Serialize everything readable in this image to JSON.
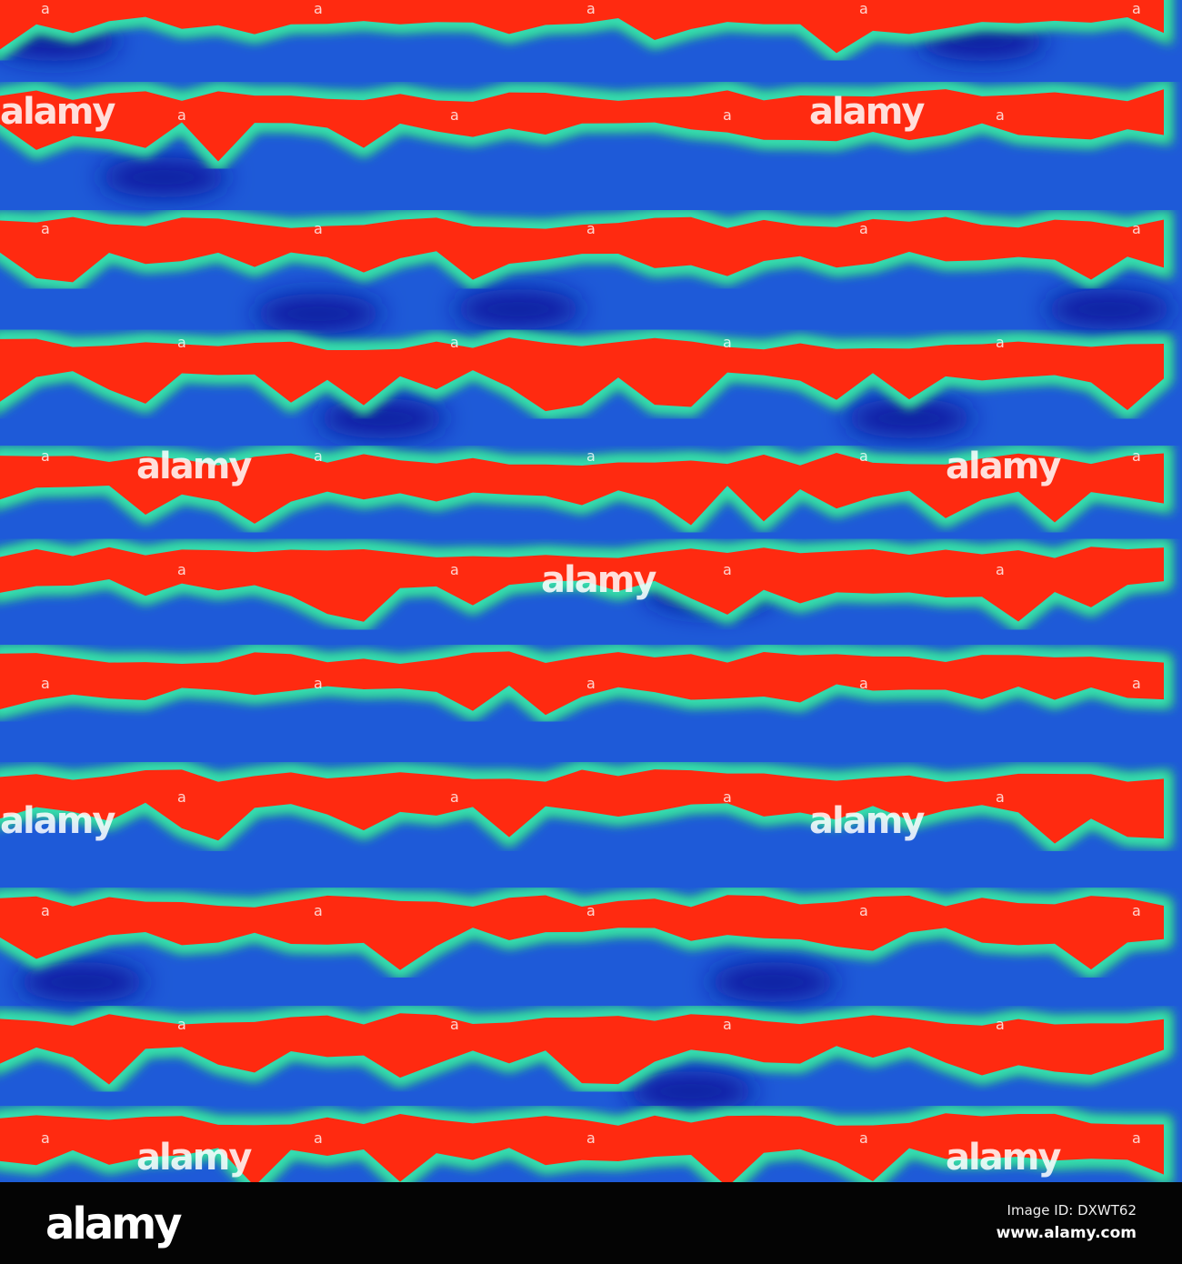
{
  "image": {
    "subject": "false-colour striped abstract pattern",
    "palette": {
      "background": "#1e55d8",
      "dark_blue": "#0a1ea0",
      "band": "#ff2a10",
      "edge": "#38e0d8",
      "green": "#30e060"
    }
  },
  "watermark": {
    "text": "alamy"
  },
  "footer": {
    "logo": "alamy",
    "image_id": "Image ID: DXWT62",
    "website": "www.alamy.com"
  }
}
